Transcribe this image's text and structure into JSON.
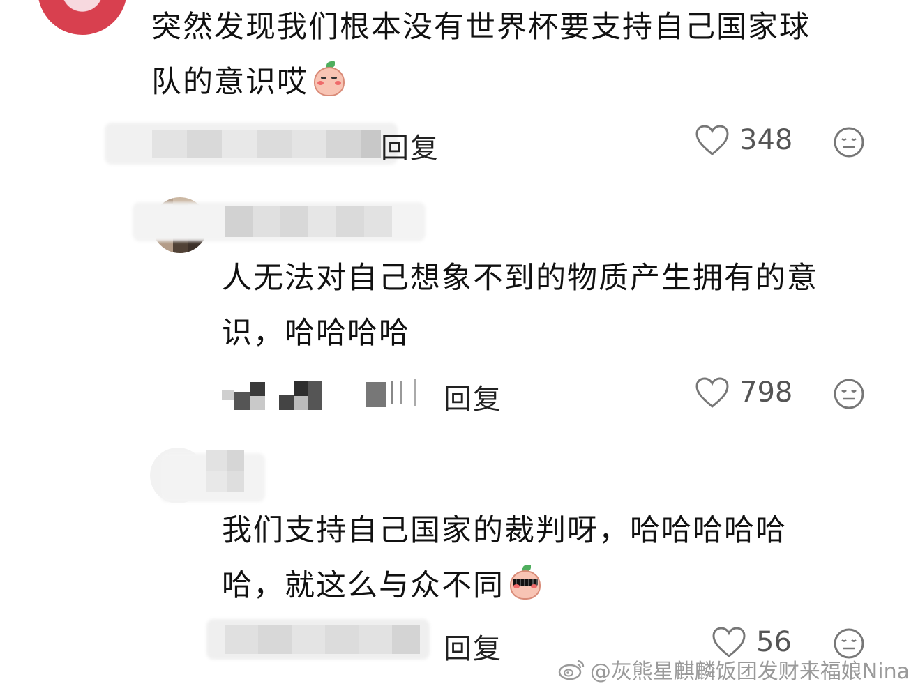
{
  "comments": [
    {
      "text_lines": [
        "突然发现我们根本没有世界杯要支持自己国家球",
        "队的意识哎"
      ],
      "sticker": "shy-peach-emoji",
      "reply_label": "回复",
      "likes": "348"
    },
    {
      "text_lines": [
        "人无法对自己想象不到的物质产生拥有的意",
        "识，哈哈哈哈"
      ],
      "reply_label": "回复",
      "likes": "798"
    },
    {
      "text_lines": [
        "我们支持自己国家的裁判呀，哈哈哈哈哈",
        "哈，就这么与众不同"
      ],
      "sticker": "cool-peach-emoji",
      "reply_label": "回复",
      "likes": "56"
    }
  ],
  "icons": {
    "like": "heart-outline-icon",
    "dislike": "meh-face-icon",
    "watermark": "weibo-icon"
  },
  "watermark": "@灰熊星麒麟饭团发财来福娘Nina",
  "colors": {
    "text": "#111111",
    "muted": "#555555",
    "icon": "#777777",
    "watermark": "#9a9a9a"
  }
}
